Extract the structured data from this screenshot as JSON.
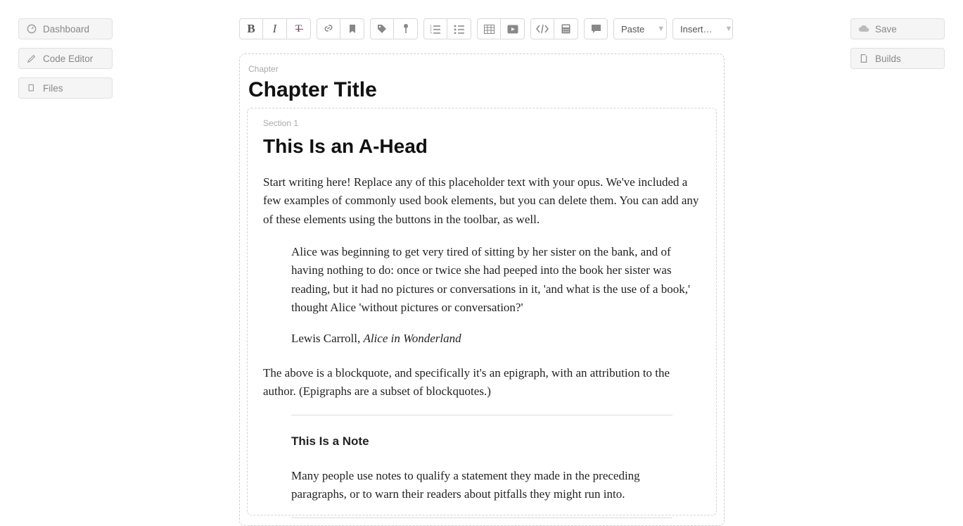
{
  "sidebar_left": {
    "dashboard": "Dashboard",
    "code_editor": "Code Editor",
    "files": "Files"
  },
  "sidebar_right": {
    "save": "Save",
    "builds": "Builds"
  },
  "toolbar": {
    "paste": "Paste",
    "insert": "Insert…"
  },
  "editor": {
    "chapter_label": "Chapter",
    "chapter_title": "Chapter Title",
    "section_label": "Section 1",
    "ahead": "This Is an A-Head",
    "para1": "Start writing here! Replace any of this placeholder text with your opus. We've included a few examples of commonly used book elements, but you can delete them. You can add any of these elements using the buttons in the toolbar, as well.",
    "quote": "Alice was beginning to get very tired of sitting by her sister on the bank, and of having nothing to do: once or twice she had peeped into the book her sister was reading, but it had no pictures or conversations in it, 'and what is the use of a book,' thought Alice 'without pictures or conversation?'",
    "attr_author": "Lewis Carroll, ",
    "attr_title": "Alice in Wonderland",
    "para2": "The above is a blockquote, and specifically it's an epigraph, with an attribution to the author. (Epigraphs are a subset of blockquotes.)",
    "note_title": "This Is a Note",
    "note_body": "Many people use notes to qualify a statement they made in the preceding paragraphs, or to warn their readers about pitfalls they might run into."
  }
}
